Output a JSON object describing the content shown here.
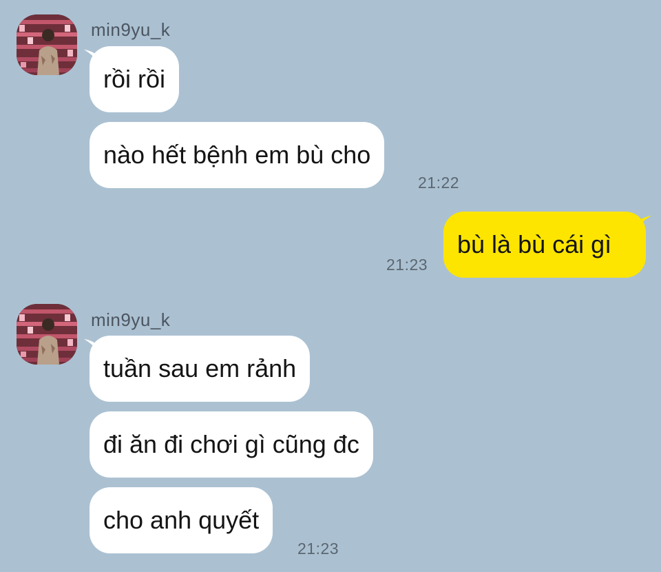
{
  "contact": {
    "name": "min9yu_k",
    "avatar_icon": "profile-photo-avatar"
  },
  "colors": {
    "background": "#abc1d2",
    "incoming_bubble": "#ffffff",
    "outgoing_bubble": "#fde500"
  },
  "group1": {
    "sender": "min9yu_k",
    "messages": [
      "rồi rồi",
      "nào hết bệnh em bù cho"
    ],
    "time": "21:22"
  },
  "group2": {
    "messages": [
      "bù là bù cái gì"
    ],
    "time": "21:23"
  },
  "group3": {
    "sender": "min9yu_k",
    "messages": [
      "tuần sau em rảnh",
      "đi ăn đi chơi gì cũng đc",
      "cho anh quyết"
    ],
    "time": "21:23"
  }
}
